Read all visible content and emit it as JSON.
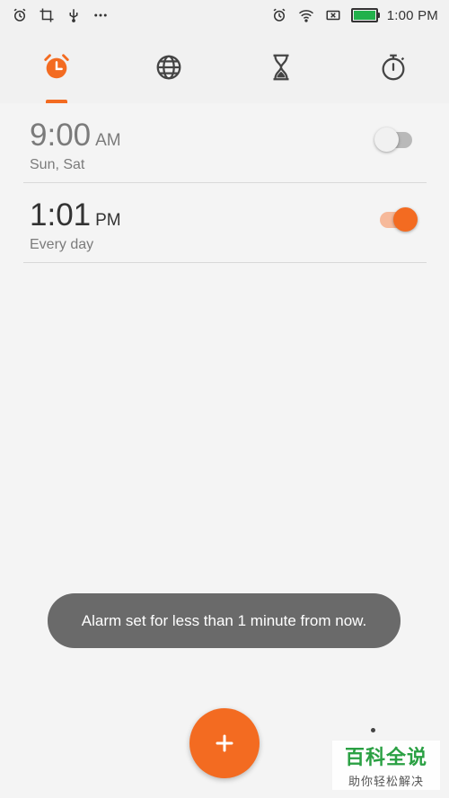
{
  "status_bar": {
    "left_icons": [
      "alarm-clock-icon",
      "crop-icon",
      "usb-icon",
      "more-dots-icon"
    ],
    "right_icons": [
      "alarm-clock-icon",
      "wifi-icon",
      "no-sim-icon",
      "battery-charging-icon"
    ],
    "time": "1:00 PM"
  },
  "tabs": [
    {
      "name": "alarm",
      "icon": "alarm-clock-icon",
      "selected": true
    },
    {
      "name": "world-clock",
      "icon": "globe-icon",
      "selected": false
    },
    {
      "name": "timer",
      "icon": "hourglass-icon",
      "selected": false
    },
    {
      "name": "stopwatch",
      "icon": "stopwatch-icon",
      "selected": false
    }
  ],
  "alarms": [
    {
      "time": "9:00",
      "ampm": "AM",
      "days": "Sun, Sat",
      "enabled": false
    },
    {
      "time": "1:01",
      "ampm": "PM",
      "days": "Every day",
      "enabled": true
    }
  ],
  "toast": {
    "message": "Alarm set for less than 1 minute from now."
  },
  "fab": {
    "icon": "plus-icon"
  },
  "watermark": {
    "title": "百科全说",
    "subtitle": "助你轻松解决"
  },
  "colors": {
    "accent": "#f36b21",
    "accent_track": "#f6b99a",
    "background": "#f4f4f4",
    "toast": "#6a6a6a",
    "watermark_green": "#2aa043"
  }
}
